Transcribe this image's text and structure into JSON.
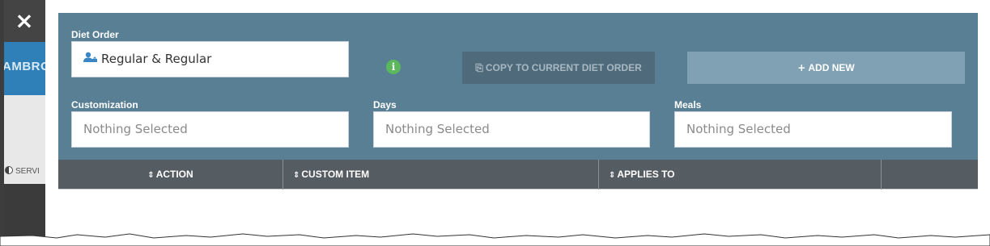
{
  "backdrop": {
    "close_label": "×",
    "banner_text": "AMBRO",
    "serving_text": "SERVI"
  },
  "form": {
    "diet_order": {
      "label": "Diet Order",
      "value": "Regular & Regular",
      "icon": "user-icon"
    },
    "info_icon_glyph": "i",
    "copy_button": {
      "icon": "copy-icon",
      "glyph": "⎘",
      "label": "COPY TO CURRENT DIET ORDER"
    },
    "add_button": {
      "icon": "plus-icon",
      "glyph": "+",
      "label": "ADD NEW"
    },
    "customization": {
      "label": "Customization",
      "placeholder": "Nothing Selected"
    },
    "days": {
      "label": "Days",
      "placeholder": "Nothing Selected"
    },
    "meals": {
      "label": "Meals",
      "placeholder": "Nothing Selected"
    }
  },
  "table": {
    "sort_glyph": "⇕",
    "columns": [
      {
        "label": "ACTION"
      },
      {
        "label": "CUSTOM ITEM"
      },
      {
        "label": "APPLIES TO"
      },
      {
        "label": ""
      }
    ]
  },
  "colors": {
    "panel": "#597f94",
    "header": "#555c62",
    "add_button": "#7fa1b3",
    "copy_button": "#4f6b7b",
    "info_icon": "#5cb85c"
  }
}
